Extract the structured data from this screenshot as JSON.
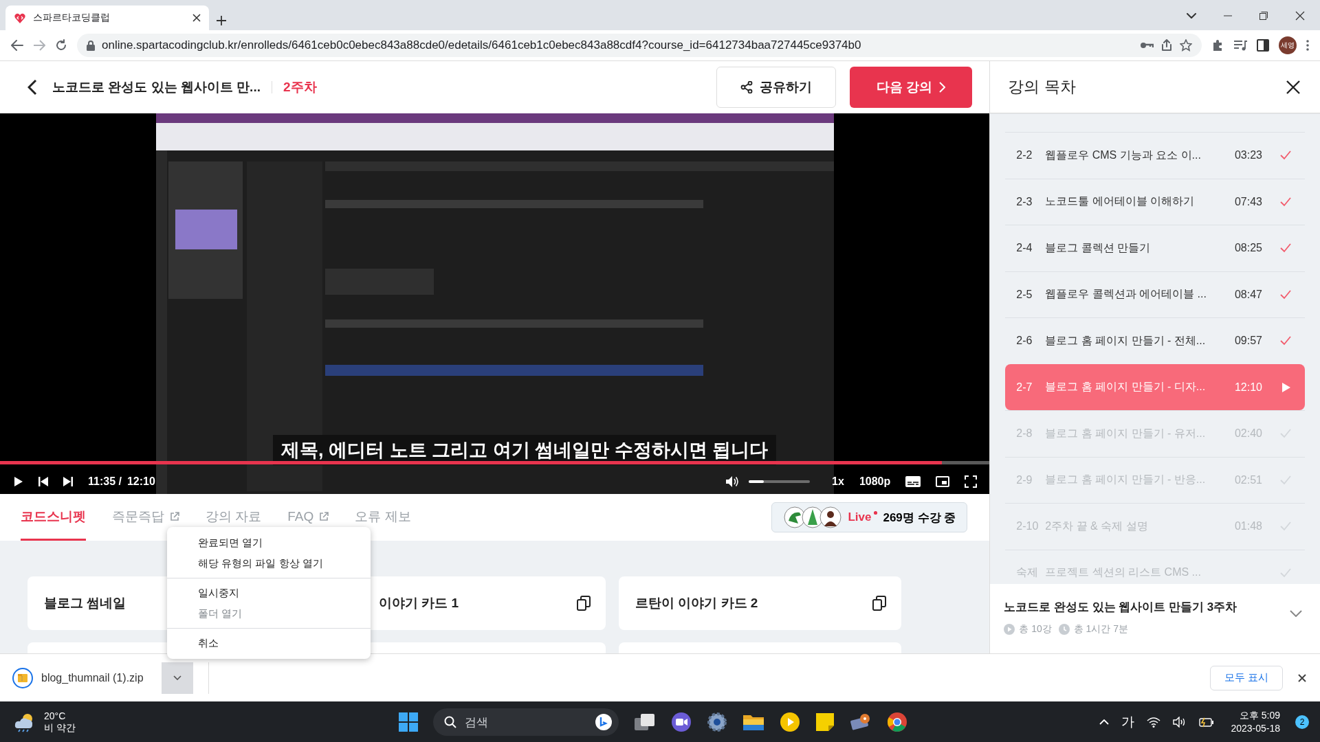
{
  "browser": {
    "tab_title": "스파르타코딩클럽",
    "url": "online.spartacodingclub.kr/enrolleds/6461ceb0c0ebec843a88cde0/edetails/6461ceb1c0ebec843a88cdf4?course_id=6412734baa727445ce9374b0",
    "profile": "세영"
  },
  "header": {
    "course_title": "노코드로 완성도 있는 웹사이트 만...",
    "week": "2주차",
    "share_button": "공유하기",
    "next_button": "다음 강의"
  },
  "player": {
    "subtitle": "제목, 에디터 노트 그리고 여기 썸네일만 수정하시면 됩니다",
    "progress": {
      "level": 0.952
    },
    "current_time": "11:35 /",
    "duration": "12:10",
    "volume": {
      "level": 0.25
    },
    "speed": "1x",
    "quality": "1080p"
  },
  "tabs": [
    {
      "label": "코드스니펫",
      "selected": true,
      "external": false
    },
    {
      "label": "즉문즉답",
      "selected": false,
      "external": true
    },
    {
      "label": "강의 자료",
      "selected": false,
      "external": false
    },
    {
      "label": "FAQ",
      "selected": false,
      "external": true
    },
    {
      "label": "오류 제보",
      "selected": false,
      "external": false
    }
  ],
  "live": {
    "label": "Live",
    "count": "269명 수강 중"
  },
  "snippets": [
    {
      "title": "블로그 썸네일"
    },
    {
      "title": "이야기 카드 1",
      "copy_icon": true
    },
    {
      "title": "르탄이 이야기 카드 2",
      "copy_icon": true
    }
  ],
  "toc": {
    "title": "강의 목차",
    "lessons": [
      {
        "number": "2-2",
        "title": "웹플로우 CMS 기능과 요소 이...",
        "duration": "03:23",
        "completed": true,
        "selected": false
      },
      {
        "number": "2-3",
        "title": "노코드툴 에어테이블 이해하기",
        "duration": "07:43",
        "completed": true,
        "selected": false
      },
      {
        "number": "2-4",
        "title": "블로그 콜렉션 만들기",
        "duration": "08:25",
        "completed": true,
        "selected": false
      },
      {
        "number": "2-5",
        "title": "웹플로우 콜렉션과 에어테이블 ...",
        "duration": "08:47",
        "completed": true,
        "selected": false
      },
      {
        "number": "2-6",
        "title": "블로그 홈 페이지 만들기 - 전체...",
        "duration": "09:57",
        "completed": true,
        "selected": false
      },
      {
        "number": "2-7",
        "title": "블로그 홈 페이지 만들기 - 디자...",
        "duration": "12:10",
        "selected": true
      },
      {
        "number": "2-8",
        "title": "블로그 홈 페이지 만들기 - 유저...",
        "duration": "02:40",
        "completed": false,
        "selected": false
      },
      {
        "number": "2-9",
        "title": "블로그 홈 페이지 만들기 - 반응...",
        "duration": "02:51",
        "completed": false,
        "selected": false
      },
      {
        "number": "2-10",
        "title": "2주차 끝 & 숙제 설명",
        "duration": "01:48",
        "completed": false,
        "selected": false
      },
      {
        "number": "숙제",
        "title": "프로젝트 섹션의 리스트 CMS ...",
        "completed": false,
        "selected": false
      }
    ],
    "next_week": {
      "title": "노코드로 완성도 있는 웹사이트 만들기 3주차",
      "lessons": "총 10강",
      "duration": "총 1시간 7분",
      "expanded": false
    }
  },
  "context_menu": {
    "groups": [
      [
        {
          "label": "완료되면 열기",
          "disabled": false
        },
        {
          "label": "해당 유형의 파일 항상 열기",
          "disabled": false
        }
      ],
      [
        {
          "label": "일시중지",
          "disabled": false
        },
        {
          "label": "폴더 열기",
          "disabled": true
        }
      ],
      [
        {
          "label": "취소",
          "disabled": false
        }
      ]
    ]
  },
  "download_bar": {
    "filename": "blog_thumnail (1).zip",
    "show_all": "모두 표시"
  },
  "taskbar": {
    "temperature": "20°C",
    "weather": "비 약간",
    "search_placeholder": "검색",
    "ime": "가",
    "time": "오후 5:09",
    "date": "2023-05-18",
    "notifications": "2"
  }
}
